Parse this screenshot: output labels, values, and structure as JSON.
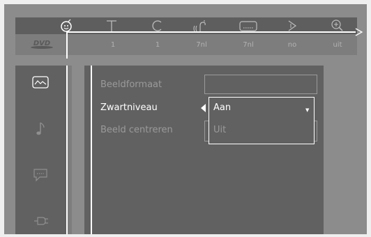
{
  "topbar": {
    "tabs": [
      {
        "icon": "smiley-icon",
        "value": ""
      },
      {
        "icon": "title-icon",
        "value": "1"
      },
      {
        "icon": "chapter-icon",
        "value": "1"
      },
      {
        "icon": "audio-icon",
        "value": "7nl"
      },
      {
        "icon": "subtitle-icon",
        "value": "7nl"
      },
      {
        "icon": "angle-icon",
        "value": "no"
      },
      {
        "icon": "zoom-icon",
        "value": "uit"
      }
    ],
    "disc_logo": "DVD"
  },
  "sidebar": {
    "items": [
      {
        "icon": "picture-icon"
      },
      {
        "icon": "music-note-icon"
      },
      {
        "icon": "speech-bubble-icon"
      },
      {
        "icon": "plug-icon"
      }
    ]
  },
  "settings": {
    "rows": [
      {
        "label": "Beeldformaat",
        "state": "disabled"
      },
      {
        "label": "Zwartniveau",
        "state": "active"
      },
      {
        "label": "Beeld centreren",
        "state": "disabled"
      }
    ],
    "dropdown": {
      "selected": "Aan",
      "options": [
        "Aan",
        "Uit"
      ]
    }
  },
  "colors": {
    "background": "#8c8c8c",
    "panel": "#616161",
    "highlight": "#ffffff",
    "disabled_text": "#9a9a9a"
  }
}
